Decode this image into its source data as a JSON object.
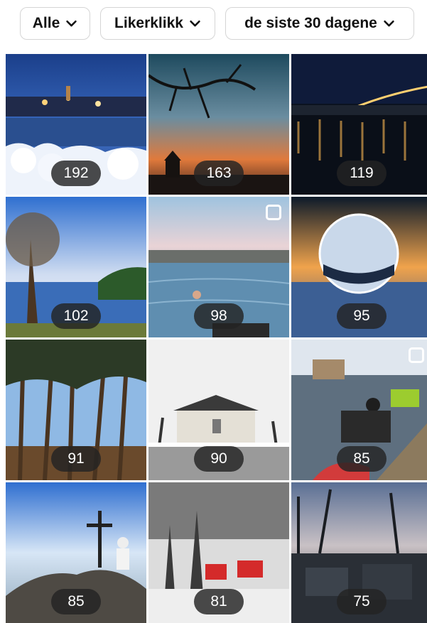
{
  "filters": [
    {
      "label": "Alle"
    },
    {
      "label": "Likerklikk"
    },
    {
      "label": "de siste 30 dagene"
    }
  ],
  "posts": [
    {
      "count": "192",
      "scene": "harbor-night-snow"
    },
    {
      "count": "163",
      "scene": "sunset-tree-silhouette"
    },
    {
      "count": "119",
      "scene": "city-lights-bridge"
    },
    {
      "count": "102",
      "scene": "lake-autumn-tree"
    },
    {
      "count": "98",
      "scene": "winter-swim",
      "multiple": true
    },
    {
      "count": "95",
      "scene": "crystal-ball"
    },
    {
      "count": "91",
      "scene": "pine-forest"
    },
    {
      "count": "90",
      "scene": "manor-winter"
    },
    {
      "count": "85",
      "scene": "kayak-dock",
      "multiple": true
    },
    {
      "count": "85",
      "scene": "summit-cairn"
    },
    {
      "count": "81",
      "scene": "red-cabins-snow"
    },
    {
      "count": "75",
      "scene": "ruins-dusk"
    }
  ]
}
